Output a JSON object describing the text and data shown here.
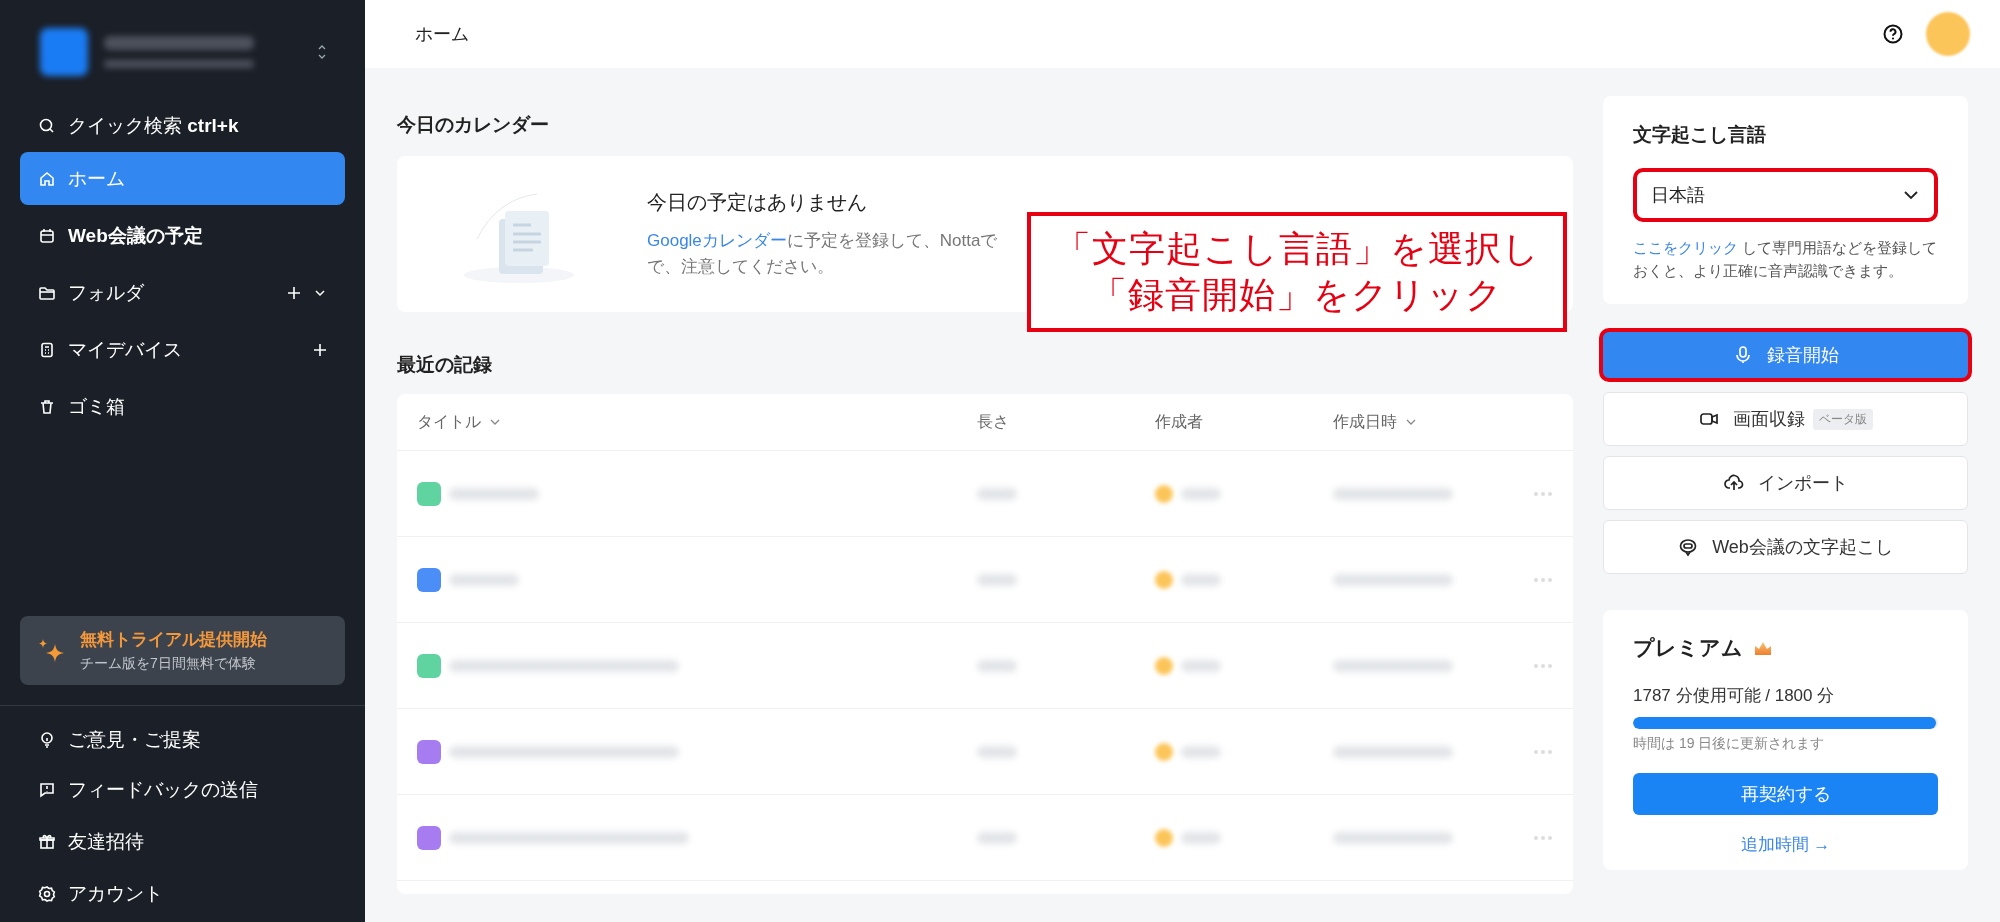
{
  "sidebar": {
    "search": {
      "label": "クイック検索",
      "shortcut": "ctrl+k"
    },
    "items": [
      {
        "label": "ホーム",
        "selected": true,
        "add": false,
        "expand": false,
        "bold": false
      },
      {
        "label": "Web会議の予定",
        "selected": false,
        "add": false,
        "expand": false,
        "bold": true
      },
      {
        "label": "フォルダ",
        "selected": false,
        "add": true,
        "expand": true,
        "bold": false
      },
      {
        "label": "マイデバイス",
        "selected": false,
        "add": true,
        "expand": false,
        "bold": false
      },
      {
        "label": "ゴミ箱",
        "selected": false,
        "add": false,
        "expand": false,
        "bold": false
      }
    ],
    "trial": {
      "title": "無料トライアル提供開始",
      "subtitle": "チーム版を7日間無料で体験"
    },
    "bottom_items": [
      {
        "label": "ご意見・ご提案"
      },
      {
        "label": "フィードバックの送信"
      },
      {
        "label": "友達招待"
      },
      {
        "label": "アカウント"
      }
    ]
  },
  "header": {
    "breadcrumb": "ホーム"
  },
  "calendar": {
    "heading": "今日のカレンダー",
    "empty_title": "今日の予定はありません",
    "link": "Googleカレンダー",
    "line1": "に予定を登録して、Nottaで",
    "line2": "で、注意してください。"
  },
  "annotation": {
    "lines": [
      "「文字起こし言語」を選択し",
      "「録音開始」をクリック"
    ]
  },
  "records": {
    "heading": "最近の記録",
    "columns": [
      {
        "label": "タイトル",
        "sortable": true
      },
      {
        "label": "長さ",
        "sortable": false
      },
      {
        "label": "作成者",
        "sortable": false
      },
      {
        "label": "作成日時",
        "sortable": true
      }
    ],
    "rows": [
      {
        "color": "#5fd3a0"
      },
      {
        "color": "#4c8ef7"
      },
      {
        "color": "#5fd3a0"
      },
      {
        "color": "#a77cf0"
      },
      {
        "color": "#a77cf0"
      }
    ]
  },
  "language": {
    "heading": "文字起こし言語",
    "value": "日本語",
    "highlighted": true,
    "link": "ここをクリック",
    "hint": "して専門用語などを登録しておくと、より正確に音声認識できます。"
  },
  "actions": [
    {
      "label": "録音開始",
      "kind": "primary",
      "highlighted": true
    },
    {
      "label": "画面収録",
      "kind": "secondary",
      "badge": "ベータ版",
      "highlighted": false
    },
    {
      "label": "インポート",
      "kind": "secondary",
      "highlighted": false
    },
    {
      "label": "Web会議の文字起こし",
      "kind": "secondary",
      "highlighted": false
    }
  ],
  "premium": {
    "title": "プレミアム",
    "usage": "1787 分使用可能 / 1800 分",
    "level": 0.993,
    "renew": "時間は 19 日後に更新されます",
    "button": "再契約する",
    "link": "追加時間 →"
  }
}
